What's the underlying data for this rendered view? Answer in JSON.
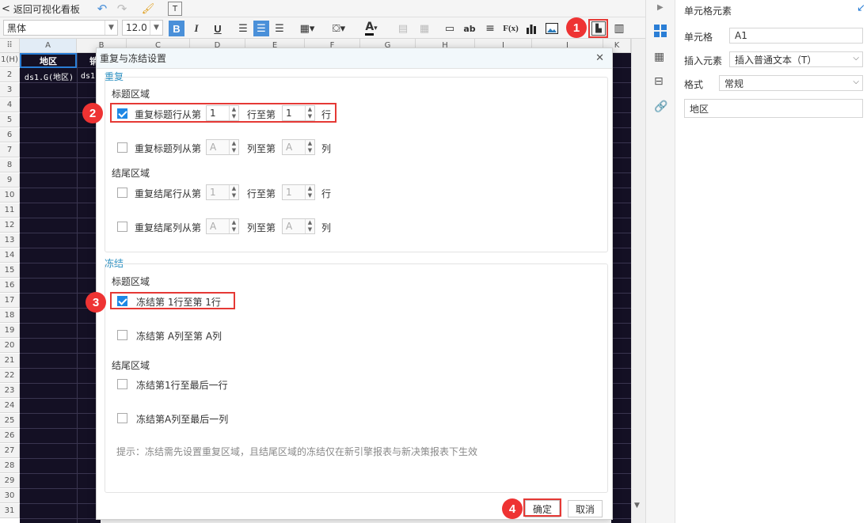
{
  "toolbar": {
    "back_label": "返回可视化看板",
    "font_name": "黑体",
    "font_size": "12.0",
    "bold": "B",
    "italic": "I",
    "underline": "U",
    "text_color_glyph": "A",
    "text_icon": "ab",
    "formula_icon": "F(x)"
  },
  "sheet": {
    "columns": [
      "A",
      "B",
      "C",
      "D",
      "E",
      "F",
      "G",
      "H",
      "I",
      "J",
      "K"
    ],
    "rows": [
      "1(H)",
      "2",
      "3",
      "4",
      "5",
      "6",
      "7",
      "8",
      "9",
      "10",
      "11",
      "12",
      "13",
      "14",
      "15",
      "16",
      "17",
      "18",
      "19",
      "20",
      "21",
      "22",
      "23",
      "24",
      "25",
      "26",
      "27",
      "28",
      "29",
      "30",
      "31"
    ],
    "cell_a1": "地区",
    "cell_a2": "ds1.G(地区)",
    "cell_b2": "ds1",
    "cell_b1": "销"
  },
  "markers": {
    "m1": "1",
    "m2": "2",
    "m3": "3",
    "m4": "4"
  },
  "dialog": {
    "title": "重复与冻结设置",
    "repeat_section": "重复",
    "title_area": "标题区域",
    "repeat_title_row": {
      "label": "重复标题行从第",
      "from": "1",
      "mid": "行至第",
      "to": "1",
      "end": "行"
    },
    "repeat_title_col": {
      "label": "重复标题列从第",
      "from": "A",
      "mid": "列至第",
      "to": "A",
      "end": "列"
    },
    "tail_area": "结尾区域",
    "repeat_tail_row": {
      "label": "重复结尾行从第",
      "from": "1",
      "mid": "行至第",
      "to": "1",
      "end": "行"
    },
    "repeat_tail_col": {
      "label": "重复结尾列从第",
      "from": "A",
      "mid": "列至第",
      "to": "A",
      "end": "列"
    },
    "freeze_section": "冻结",
    "freeze_title_area": "标题区域",
    "freeze_row": "冻结第 1行至第 1行",
    "freeze_col": "冻结第 A列至第 A列",
    "freeze_tail_area": "结尾区域",
    "freeze_tail_row": "冻结第1行至最后一行",
    "freeze_tail_col": "冻结第A列至最后一列",
    "hint": "提示：冻结需先设置重复区域，且结尾区域的冻结仅在新引擎报表与新决策报表下生效",
    "ok": "确定",
    "cancel": "取消",
    "close_glyph": "✕"
  },
  "right_panel": {
    "title": "单元格元素",
    "cell_label": "单元格",
    "cell_value": "A1",
    "insert_label": "插入元素",
    "insert_value": "插入普通文本（T）",
    "format_label": "格式",
    "format_value": "常规",
    "content_value": "地区"
  },
  "colors": {
    "accent": "#1e88e5",
    "marker": "#e33333",
    "dark_cells": "#141024"
  }
}
